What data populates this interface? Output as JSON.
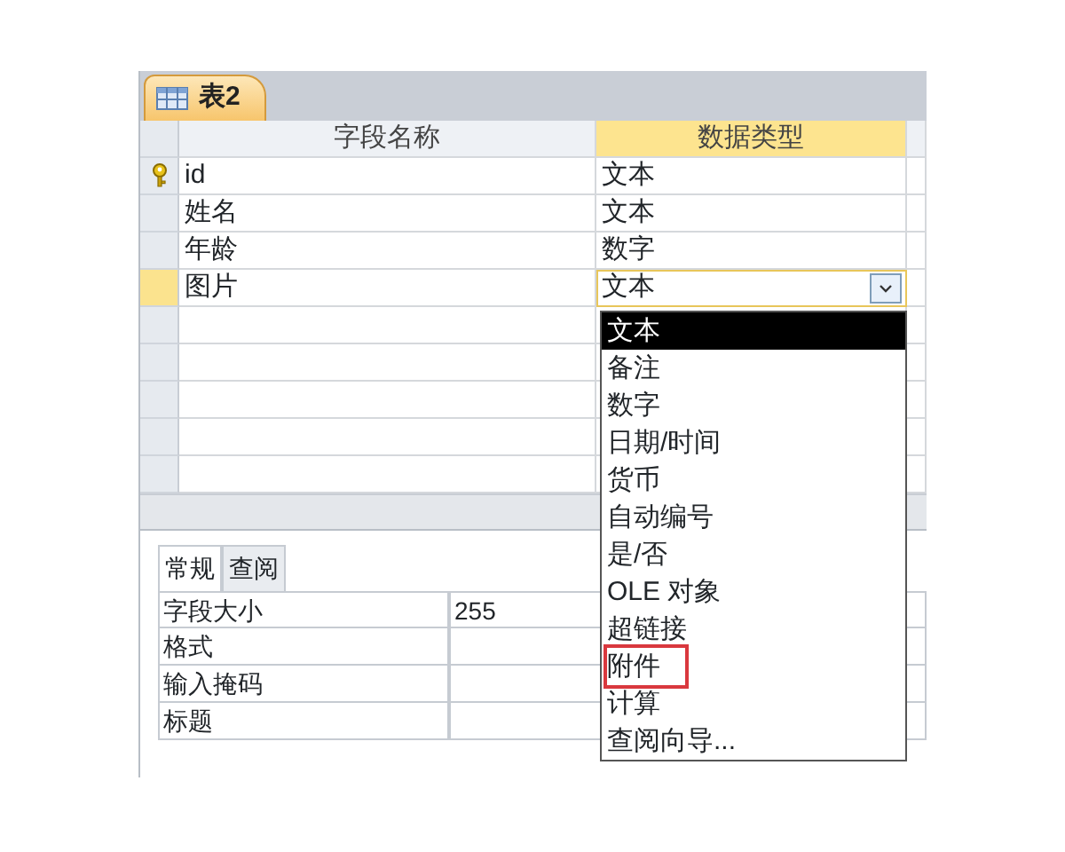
{
  "document_tab": {
    "label": "表2",
    "selected": true
  },
  "grid": {
    "columns": [
      {
        "label": "字段名称",
        "selected": false
      },
      {
        "label": "数据类型",
        "selected": true
      }
    ],
    "rows": [
      {
        "name": "id",
        "type": "文本",
        "primary_key": true,
        "current": false
      },
      {
        "name": "姓名",
        "type": "文本",
        "primary_key": false,
        "current": false
      },
      {
        "name": "年龄",
        "type": "数字",
        "primary_key": false,
        "current": false
      },
      {
        "name": "图片",
        "type": "文本",
        "primary_key": false,
        "current": true
      }
    ]
  },
  "dropdown": {
    "items": [
      {
        "label": "文本",
        "selected": true,
        "outlined": false
      },
      {
        "label": "备注",
        "selected": false,
        "outlined": false
      },
      {
        "label": "数字",
        "selected": false,
        "outlined": false
      },
      {
        "label": "日期/时间",
        "selected": false,
        "outlined": false
      },
      {
        "label": "货币",
        "selected": false,
        "outlined": false
      },
      {
        "label": "自动编号",
        "selected": false,
        "outlined": false
      },
      {
        "label": "是/否",
        "selected": false,
        "outlined": false
      },
      {
        "label": "OLE 对象",
        "selected": false,
        "outlined": false
      },
      {
        "label": "超链接",
        "selected": false,
        "outlined": false
      },
      {
        "label": "附件",
        "selected": false,
        "outlined": true
      },
      {
        "label": "计算",
        "selected": false,
        "outlined": false
      },
      {
        "label": "查阅向导...",
        "selected": false,
        "outlined": false
      }
    ]
  },
  "properties": {
    "tabs": [
      {
        "label": "常规",
        "selected": true
      },
      {
        "label": "查阅",
        "selected": false
      }
    ],
    "rows": [
      {
        "label": "字段大小",
        "value": "255"
      },
      {
        "label": "格式"
      },
      {
        "label": "输入掩码"
      },
      {
        "label": "标题"
      }
    ]
  }
}
